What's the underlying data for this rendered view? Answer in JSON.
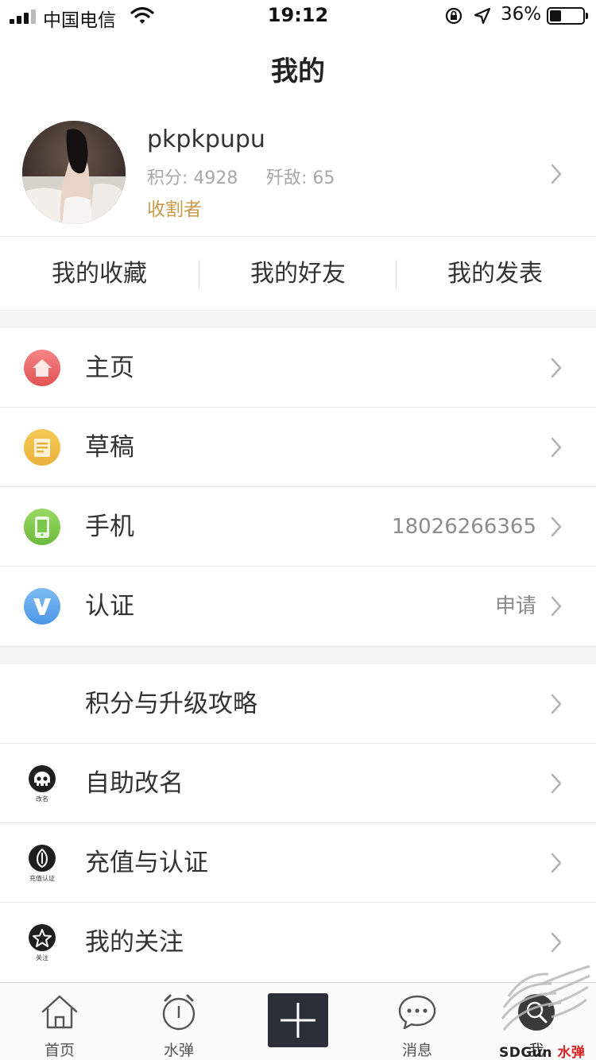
{
  "status_bar": {
    "carrier": "中国电信",
    "time": "19:12",
    "battery_percent": "36%",
    "battery_level": 0.36,
    "icons": [
      "signal-icon",
      "wifi-icon",
      "rotation-lock-icon",
      "location-arrow-icon",
      "battery-icon"
    ]
  },
  "header": {
    "title": "我的"
  },
  "profile": {
    "username": "pkpkpupu",
    "score": "积分: 4928",
    "kills": "歼敌: 65",
    "rank": "收割者"
  },
  "quick_tabs": [
    {
      "label": "我的收藏"
    },
    {
      "label": "我的好友"
    },
    {
      "label": "我的发表"
    }
  ],
  "menu_group_1": [
    {
      "label": "主页",
      "value": "",
      "icon": "home-icon",
      "color": "#ec6464"
    },
    {
      "label": "草稿",
      "value": "",
      "icon": "draft-icon",
      "color": "#f0bb3c"
    },
    {
      "label": "手机",
      "value": "18026266365",
      "icon": "phone-icon",
      "color": "#7cc84a"
    },
    {
      "label": "认证",
      "value": "申请",
      "icon": "verify-icon",
      "color": "#5ea8ee"
    }
  ],
  "menu_group_2": [
    {
      "label": "积分与升级攻略",
      "icon": ""
    },
    {
      "label": "自助改名",
      "icon": "skull-icon",
      "badge_caption": "改名"
    },
    {
      "label": "充值与认证",
      "icon": "bullet-icon",
      "badge_caption": "充值认证"
    },
    {
      "label": "我的关注",
      "icon": "star-icon",
      "badge_caption": "关注"
    }
  ],
  "tab_bar": {
    "items": [
      {
        "label": "首页",
        "icon": "home-outline-icon"
      },
      {
        "label": "水弹",
        "icon": "alarm-clock-icon"
      },
      {
        "label": "",
        "icon": "plus-icon"
      },
      {
        "label": "消息",
        "icon": "chat-bubble-icon"
      },
      {
        "label": "我",
        "icon": "profile-icon"
      }
    ]
  },
  "watermark": {
    "text_a": "SDGun",
    "text_b": "水弹"
  }
}
